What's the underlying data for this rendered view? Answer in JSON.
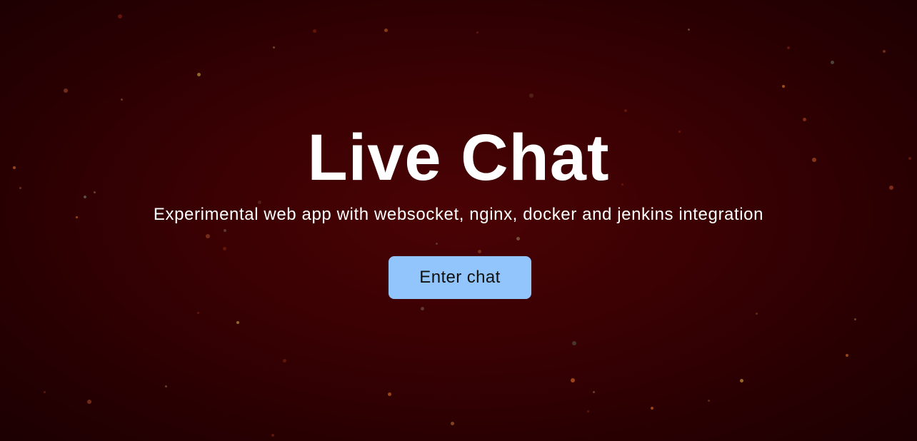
{
  "hero": {
    "title": "Live Chat",
    "subtitle": "Experimental web app with websocket, nginx, docker and jenkins integration",
    "enter_button_label": "Enter chat"
  },
  "colors": {
    "background_center": "#4a0204",
    "background_edge": "#1c0002",
    "button_background": "#93c5fd",
    "button_text": "#111111",
    "text": "#ffffff"
  }
}
